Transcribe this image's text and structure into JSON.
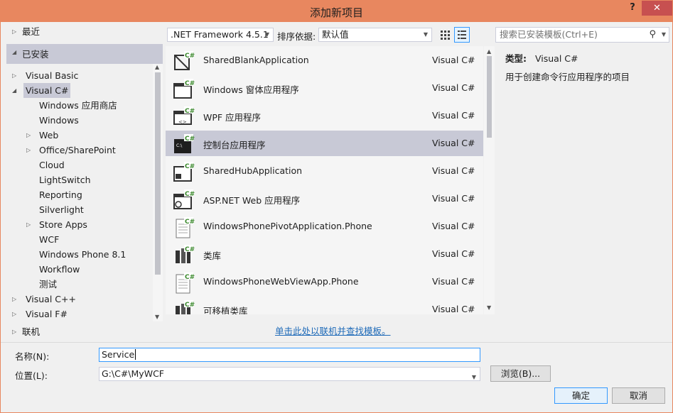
{
  "window": {
    "title": "添加新项目"
  },
  "titlebar": {
    "help": "?",
    "close": "✕"
  },
  "tree": {
    "recent": "最近",
    "installed": "已安装",
    "items": [
      {
        "label": "Visual Basic",
        "level": 1,
        "expander": "collapsed"
      },
      {
        "label": "Visual C#",
        "level": 1,
        "expander": "expanded",
        "selected": true
      },
      {
        "label": "Windows 应用商店",
        "level": 2
      },
      {
        "label": "Windows",
        "level": 2
      },
      {
        "label": "Web",
        "level": 2,
        "expander": "collapsed"
      },
      {
        "label": "Office/SharePoint",
        "level": 2,
        "expander": "collapsed"
      },
      {
        "label": "Cloud",
        "level": 2
      },
      {
        "label": "LightSwitch",
        "level": 2
      },
      {
        "label": "Reporting",
        "level": 2
      },
      {
        "label": "Silverlight",
        "level": 2
      },
      {
        "label": "Store Apps",
        "level": 2,
        "expander": "collapsed"
      },
      {
        "label": "WCF",
        "level": 2
      },
      {
        "label": "Windows Phone 8.1",
        "level": 2
      },
      {
        "label": "Workflow",
        "level": 2
      },
      {
        "label": "测试",
        "level": 2
      },
      {
        "label": "Visual C++",
        "level": 1,
        "expander": "collapsed"
      },
      {
        "label": "Visual F#",
        "level": 1,
        "expander": "collapsed"
      }
    ],
    "online": "联机"
  },
  "toolbar": {
    "framework": ".NET Framework 4.5.1",
    "sort_label": "排序依据:",
    "sort_value": "默认值",
    "search_placeholder": "搜索已安装模板(Ctrl+E)"
  },
  "templates": [
    {
      "name": "SharedBlankApplication",
      "lang": "Visual C#",
      "icon": "shared-blank-icon"
    },
    {
      "name": "Windows 窗体应用程序",
      "lang": "Visual C#",
      "icon": "windows-forms-icon"
    },
    {
      "name": "WPF 应用程序",
      "lang": "Visual C#",
      "icon": "wpf-icon"
    },
    {
      "name": "控制台应用程序",
      "lang": "Visual C#",
      "icon": "console-icon",
      "selected": true
    },
    {
      "name": "SharedHubApplication",
      "lang": "Visual C#",
      "icon": "shared-hub-icon"
    },
    {
      "name": "ASP.NET Web 应用程序",
      "lang": "Visual C#",
      "icon": "web-app-icon"
    },
    {
      "name": "WindowsPhonePivotApplication.Phone",
      "lang": "Visual C#",
      "icon": "document-icon"
    },
    {
      "name": "类库",
      "lang": "Visual C#",
      "icon": "class-library-icon"
    },
    {
      "name": "WindowsPhoneWebViewApp.Phone",
      "lang": "Visual C#",
      "icon": "document-icon"
    },
    {
      "name": "可移植类库",
      "lang": "Visual C#",
      "icon": "portable-library-icon"
    }
  ],
  "details": {
    "type_label": "类型:",
    "type_value": "Visual C#",
    "description": "用于创建命令行应用程序的项目"
  },
  "online_link": "单击此处以联机并查找模板。",
  "form": {
    "name_label": "名称(N):",
    "name_value": "Service",
    "location_label": "位置(L):",
    "location_value": "G:\\C#\\MyWCF",
    "browse": "浏览(B)...",
    "ok": "确定",
    "cancel": "取消"
  },
  "colors": {
    "titlebar": "#e8875f",
    "selection": "#c8c9d6",
    "link": "#1e6ab8",
    "close": "#c75050"
  }
}
